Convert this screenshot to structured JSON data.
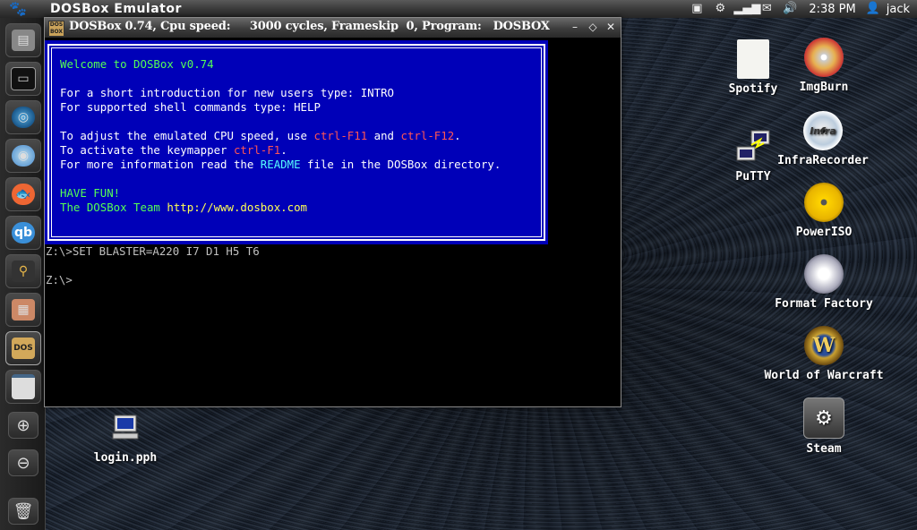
{
  "top_panel": {
    "app_title": "DOSBox Emulator",
    "clock": "2:38 PM",
    "user": "jack"
  },
  "window": {
    "title": "DOSBox 0.74, Cpu speed:     3000 cycles, Frameskip  0, Program:   DOSBOX"
  },
  "welcome": {
    "line1": "Welcome to DOSBox v0.74",
    "line2": "For a short introduction for new users type: INTRO",
    "line3": "For supported shell commands type: HELP",
    "line4a": "To adjust the emulated CPU speed, use ",
    "line4b": "ctrl-F11",
    "line4c": " and ",
    "line4d": "ctrl-F12",
    "line4e": ".",
    "line5a": "To activate the keymapper ",
    "line5b": "ctrl-F1",
    "line5c": ".",
    "line6a": "For more information read the ",
    "line6b": "README",
    "line6c": " file in the DOSBox directory.",
    "line7": "HAVE FUN!",
    "line8a": "The DOSBox Team ",
    "line8b": "http://www.dosbox.com"
  },
  "console": {
    "line1": "Z:\\>SET BLASTER=A220 I7 D1 H5 T6",
    "line2": "Z:\\>"
  },
  "desktop_icons": {
    "spotify": "Spotify",
    "imgburn": "ImgBurn",
    "putty": "PuTTY",
    "infrarecorder": "InfraRecorder",
    "poweriso": "PowerISO",
    "format_factory": "Format Factory",
    "wow": "World of Warcraft",
    "steam": "Steam",
    "login": "login.pph"
  }
}
